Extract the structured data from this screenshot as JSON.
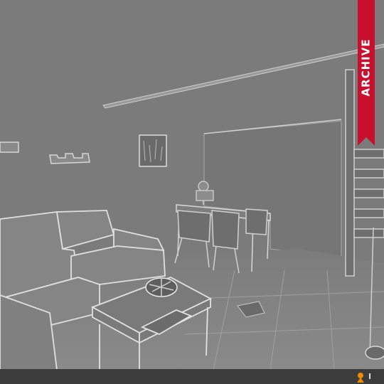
{
  "badge": {
    "label": "ARCHIVE",
    "color": "#c8102e"
  },
  "footer": {
    "logo_text": "I"
  },
  "scene": {
    "description_icons": [
      "sofa-icon",
      "table-icon",
      "chair-icon",
      "bowl-icon",
      "picture-frame-icon",
      "shelf-icon",
      "staircase-icon"
    ]
  }
}
